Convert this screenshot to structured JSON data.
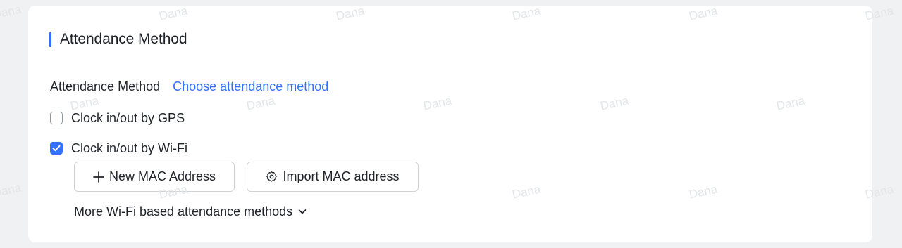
{
  "section": {
    "title": "Attendance Method"
  },
  "method": {
    "label": "Attendance Method",
    "link": "Choose attendance method"
  },
  "options": [
    {
      "label": "Clock in/out by GPS",
      "checked": false
    },
    {
      "label": "Clock in/out by Wi-Fi",
      "checked": true
    }
  ],
  "buttons": {
    "new_mac": {
      "label": "New MAC Address",
      "icon": "plus-icon"
    },
    "import_mac": {
      "label": "Import MAC address",
      "icon": "gear-icon"
    }
  },
  "more": {
    "label": "More Wi-Fi based attendance methods",
    "icon": "chevron-down-icon"
  },
  "watermark": {
    "text": "Dana"
  },
  "colors": {
    "accent": "#3370ff",
    "background": "#f0f1f3",
    "card": "#ffffff",
    "text": "#1f2329"
  }
}
